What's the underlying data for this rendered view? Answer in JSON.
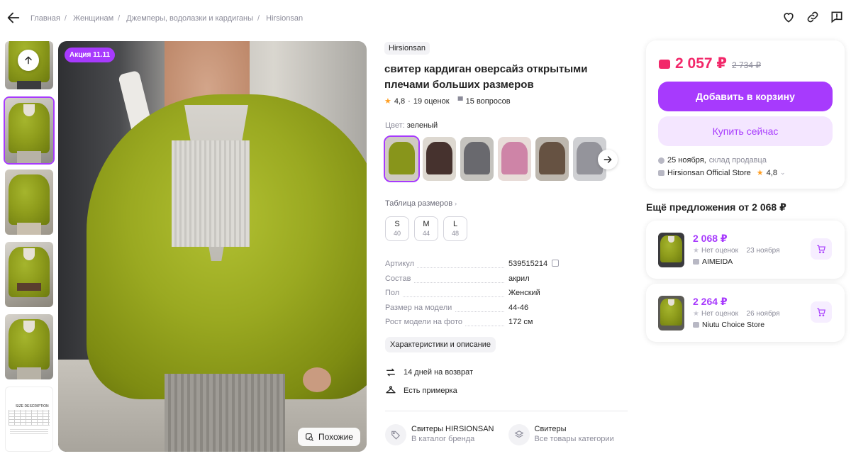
{
  "breadcrumbs": [
    "Главная",
    "Женщинам",
    "Джемперы, водолазки и кардиганы",
    "Hirsionsan"
  ],
  "gallery": {
    "badge": "Акция 11.11",
    "similar_label": "Похожие",
    "size_table_thumb_title": "SIZE DESCRIPTION"
  },
  "product": {
    "brand": "Hirsionsan",
    "title": "свитер кардиган оверсайз открытыми плечами больших размеров",
    "rating": "4,8",
    "reviews": "19 оценок",
    "questions": "15 вопросов",
    "color_label": "Цвет:",
    "color_value": "зеленый",
    "swatch_colors": [
      "#8f9d1c",
      "#4a3530",
      "#6f6f74",
      "#d98bb0",
      "#6b5646",
      "#9c9ca3"
    ],
    "size_table_label": "Таблица размеров",
    "sizes": [
      {
        "size": "S",
        "ru": "40"
      },
      {
        "size": "M",
        "ru": "44"
      },
      {
        "size": "L",
        "ru": "48"
      }
    ],
    "specs": [
      {
        "key": "Артикул",
        "value": "539515214"
      },
      {
        "key": "Состав",
        "value": "акрил"
      },
      {
        "key": "Пол",
        "value": "Женский"
      },
      {
        "key": "Размер на модели",
        "value": "44-46"
      },
      {
        "key": "Рост модели на фото",
        "value": "172 см"
      }
    ],
    "chars_button": "Характеристики и описание",
    "perks": [
      "14 дней на возврат",
      "Есть примерка"
    ],
    "links": [
      {
        "title": "Свитеры HIRSIONSAN",
        "subtitle": "В каталог бренда"
      },
      {
        "title": "Свитеры",
        "subtitle": "Все товары категории"
      }
    ]
  },
  "buy_box": {
    "price": "2 057 ₽",
    "old_price": "2 734 ₽",
    "add_to_cart": "Добавить в корзину",
    "buy_now": "Купить сейчас",
    "delivery": "25 ноября,",
    "delivery_source": "склад продавца",
    "seller": "Hirsionsan Official Store",
    "seller_rating": "4,8",
    "accent": "#a73afd",
    "price_color": "#f2286a"
  },
  "other_offers": {
    "title": "Ещё предложения от 2 068 ₽",
    "items": [
      {
        "price": "2 068 ₽",
        "reviews": "Нет оценок",
        "date": "23 ноября",
        "seller": "AIMEIDA"
      },
      {
        "price": "2 264 ₽",
        "reviews": "Нет оценок",
        "date": "26 ноября",
        "seller": "Niutu Choice Store"
      }
    ]
  }
}
